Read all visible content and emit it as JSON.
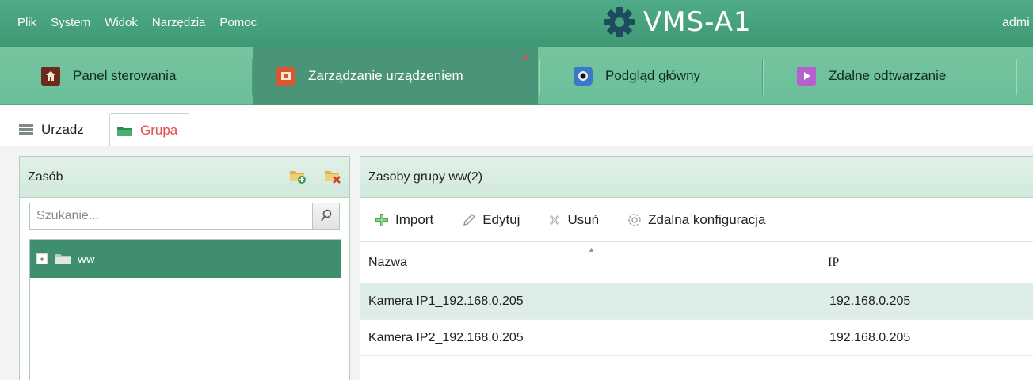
{
  "menu": [
    "Plik",
    "System",
    "Widok",
    "Narzędzia",
    "Pomoc"
  ],
  "app_title": "VMS-A1",
  "user": "admi",
  "modules": [
    {
      "label": "Panel sterowania"
    },
    {
      "label": "Zarządzanie urządzeniem"
    },
    {
      "label": "Podgląd główny"
    },
    {
      "label": "Zdalne odtwarzanie"
    }
  ],
  "close_mark": "×",
  "subtabs": [
    {
      "label": "Urzadz"
    },
    {
      "label": "Grupa"
    }
  ],
  "left": {
    "title": "Zasób",
    "search_placeholder": "Szukanie...",
    "tree": [
      {
        "label": "ww",
        "expander": "+"
      }
    ]
  },
  "right": {
    "title": "Zasoby grupy ww(2)",
    "toolbar": [
      {
        "label": "Import",
        "icon": "plus-icon"
      },
      {
        "label": "Edytuj",
        "icon": "pencil-icon"
      },
      {
        "label": "Usuń",
        "icon": "delete-icon"
      },
      {
        "label": "Zdalna konfiguracja",
        "icon": "gear-icon"
      }
    ],
    "columns": [
      "Nazwa",
      "IP"
    ],
    "rows": [
      {
        "name": "Kamera IP1_192.168.0.205",
        "ip": "192.168.0.205"
      },
      {
        "name": "Kamera IP2_192.168.0.205",
        "ip": "192.168.0.205"
      }
    ]
  },
  "colors": {
    "menubar": "#44a07c",
    "modbar": "#70c29b",
    "active_module": "#4a9478",
    "selected_tree": "#3f8f6f",
    "selected_row": "#dceee5",
    "active_subtab": "#e04a4a"
  }
}
